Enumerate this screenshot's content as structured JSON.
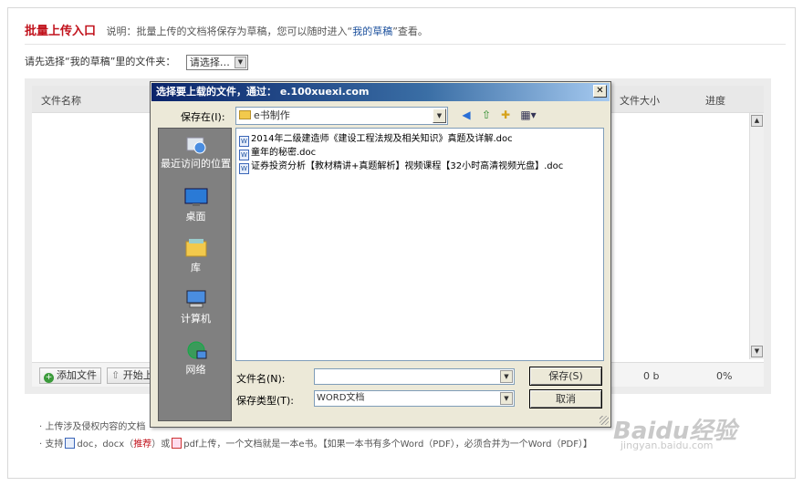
{
  "header": {
    "title": "批量上传入口",
    "desc_prefix": "说明：批量上传的文档将保存为草稿，您可以随时进入“",
    "desc_link": "我的草稿",
    "desc_suffix": "”查看。"
  },
  "folder_select": {
    "label": "请先选择“我的草稿”里的文件夹：",
    "value": "请选择…"
  },
  "upload_table": {
    "columns": [
      "文件名称",
      "文件大小",
      "进度"
    ],
    "add_button": "添加文件",
    "start_button": "开始上",
    "size_value": "0 b",
    "progress_value": "0%"
  },
  "notes": {
    "line1": "· 上传涉及侵权内容的文档",
    "line2_a": "· 支持",
    "line2_b": "doc，docx（",
    "line2_rec": "推荐",
    "line2_c": "）或",
    "line2_d": "pdf上传，一个文档就是一本e书。【如果一本书有多个Word（PDF），必须合并为一个Word（PDF）】"
  },
  "watermark": {
    "brand": "Baidu经验",
    "url": "jingyan.baidu.com"
  },
  "dialog": {
    "title": "选择要上载的文件，通过： e.100xuexi.com",
    "look_in_label": "保存在(I):",
    "look_in_value": "e书制作",
    "places": [
      {
        "label": "最近访问的位置",
        "icon": "recent-places-icon"
      },
      {
        "label": "桌面",
        "icon": "desktop-icon"
      },
      {
        "label": "库",
        "icon": "libraries-icon"
      },
      {
        "label": "计算机",
        "icon": "computer-icon"
      },
      {
        "label": "网络",
        "icon": "network-icon"
      }
    ],
    "files": [
      "2014年二级建造师《建设工程法规及相关知识》真题及详解.doc",
      "童年的秘密.doc",
      "证券投资分析【教材精讲+真题解析】视频课程【32小时高清视频光盘】.doc"
    ],
    "filename_label": "文件名(N):",
    "filename_value": "",
    "filetype_label": "保存类型(T):",
    "filetype_value": "WORD文档",
    "save_button": "保存(S)",
    "cancel_button": "取消",
    "close_glyph": "✕"
  }
}
